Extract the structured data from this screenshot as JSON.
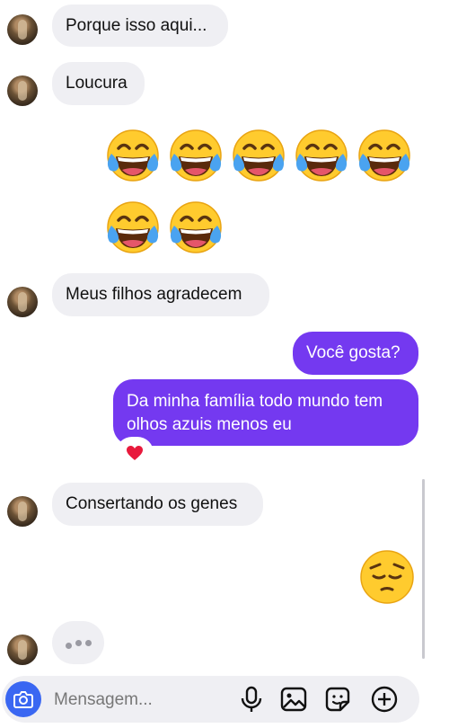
{
  "messages": [
    {
      "text": "Porque isso aqui..."
    },
    {
      "text": "Loucura"
    },
    {
      "text": "Meus filhos agradecem"
    },
    {
      "text": "Você gosta?"
    },
    {
      "text": "Da minha família todo mundo tem olhos azuis menos eu"
    },
    {
      "text": "Consertando os genes"
    }
  ],
  "laugh_emoji": {
    "row1_count": 5,
    "row2_count": 2,
    "icon": "face-with-tears-of-joy-icon"
  },
  "sad_emoji": {
    "icon": "pensive-face-icon"
  },
  "reaction": {
    "icon": "red-heart-icon"
  },
  "composer": {
    "placeholder": "Mensagem..."
  },
  "colors": {
    "outgoing_bubble": "#7439f0",
    "incoming_bubble": "#efeff3",
    "camera_button": "#3a67f2"
  }
}
